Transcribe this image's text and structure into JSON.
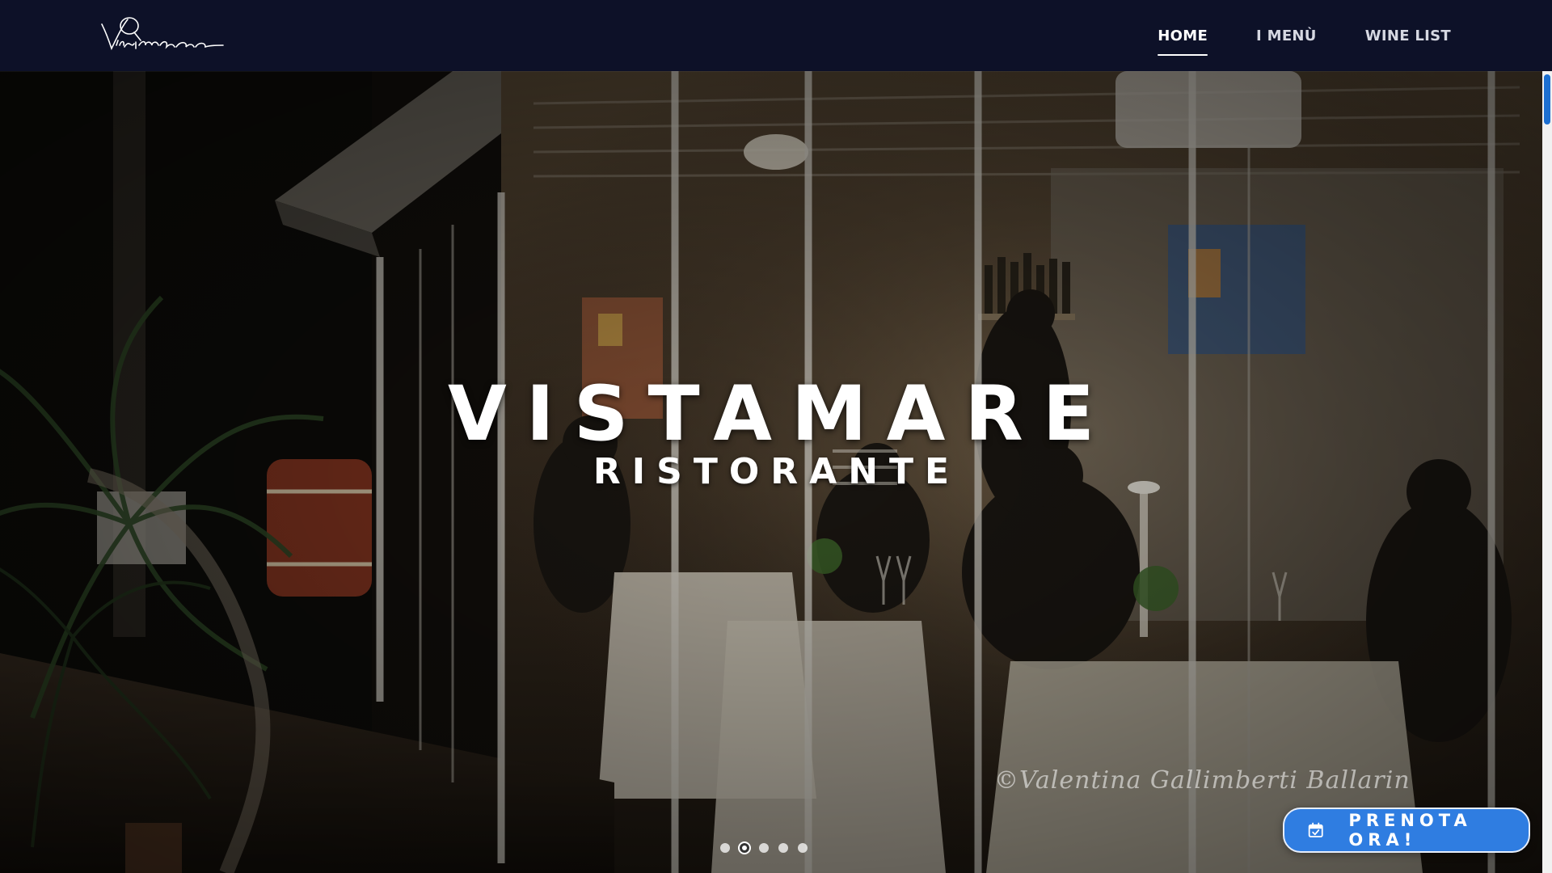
{
  "header": {
    "logo_text": "Vistamare",
    "nav": [
      {
        "label": "HOME",
        "active": true
      },
      {
        "label": "I MENÙ",
        "active": false
      },
      {
        "label": "WINE LIST",
        "active": false
      }
    ]
  },
  "hero": {
    "title": "VISTAMARE",
    "subtitle": "RISTORANTE",
    "photo_credit": "©Valentina Gallimberti Ballarin",
    "slides_count": 5,
    "active_slide": 2
  },
  "booking": {
    "label": "PRENOTA ORA!",
    "icon": "calendar-check-icon"
  },
  "colors": {
    "header_bg": "#0d1128",
    "accent": "#2f7de1",
    "scroll_thumb": "#1c6fd1"
  }
}
